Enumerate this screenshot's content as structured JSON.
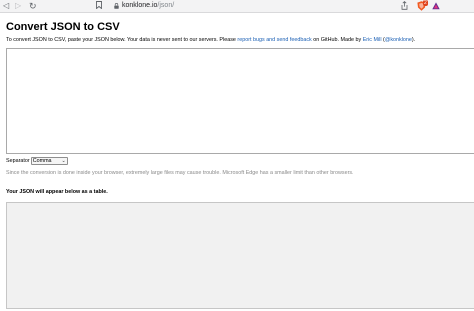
{
  "browser": {
    "back_icon": "back-arrow-icon",
    "forward_icon": "forward-arrow-icon",
    "reload_icon": "reload-icon",
    "bookmark_icon": "bookmark-icon",
    "url_host": "konklone.io",
    "url_path": "/json/",
    "share_icon": "share-icon",
    "shield_count": "2"
  },
  "page": {
    "title": "Convert JSON to CSV",
    "intro_prefix": "To convert JSON to CSV, paste your JSON below. Your data is never sent to our servers. Please ",
    "intro_link_feedback": "report bugs and send feedback",
    "intro_mid": " on GitHub. Made by ",
    "intro_link_author": "Eric Mill",
    "intro_open_paren": " (",
    "intro_link_handle": "@konklone",
    "intro_close": ").",
    "json_input_value": "",
    "separator_label": "Separator",
    "separator_value": "Comma",
    "note": "Since the conversion is done inside your browser, extremely large files may cause trouble. Microsoft Edge has a smaller limit than other browsers.",
    "table_label": "Your JSON will appear below as a table."
  }
}
